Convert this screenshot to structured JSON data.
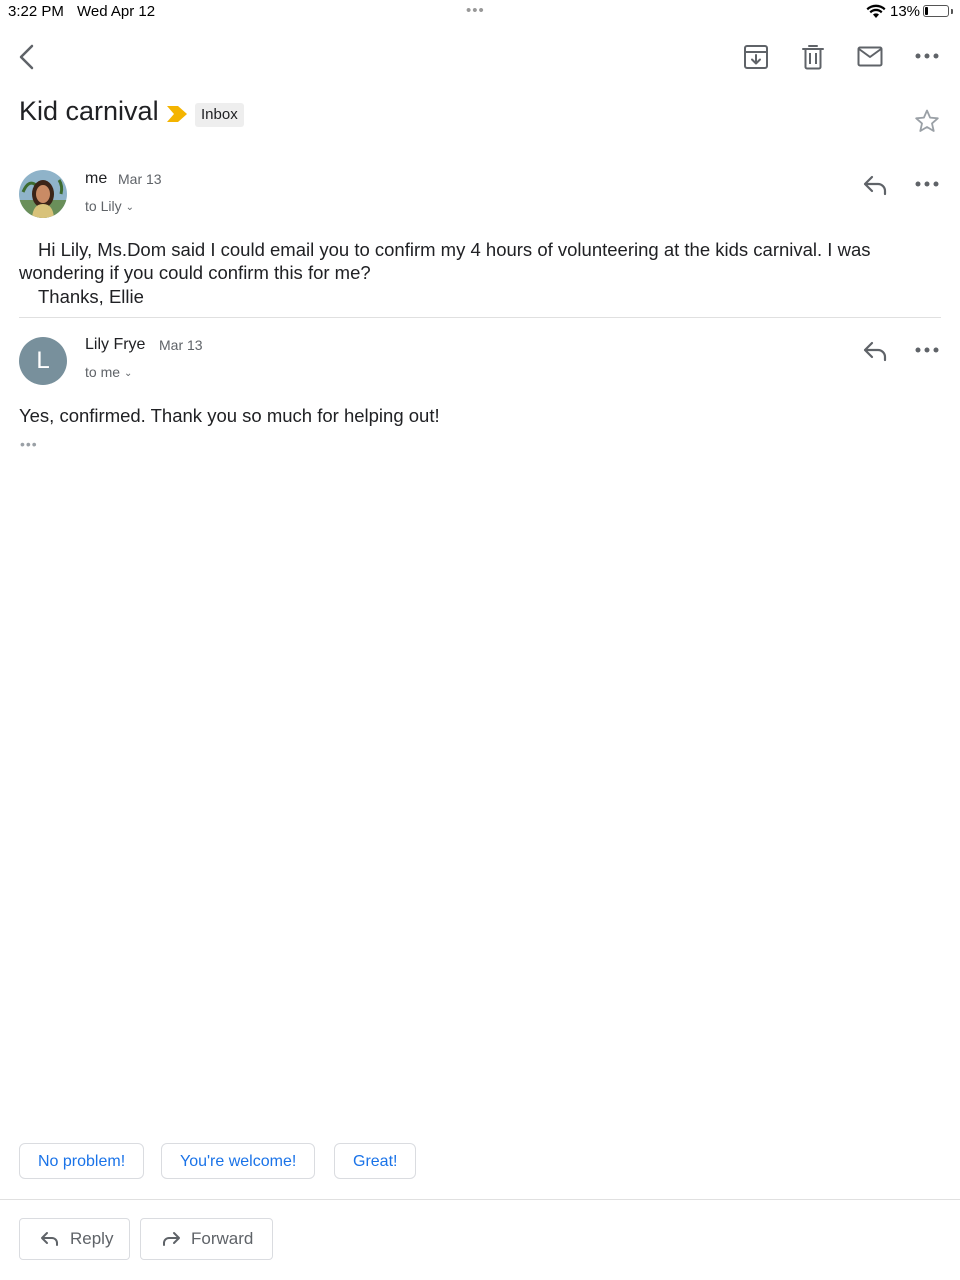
{
  "status_bar": {
    "time": "3:22 PM",
    "date": "Wed Apr 12",
    "multitask_dots": "•••",
    "battery_percent": "13%",
    "battery_level": 0.13,
    "wifi_icon": "wifi-icon",
    "battery_icon": "battery-icon"
  },
  "toolbar": {
    "icons": [
      "back-arrow-icon",
      "archive-icon",
      "trash-icon",
      "mail-icon",
      "more-horizontal-icon"
    ]
  },
  "thread": {
    "subject": "Kid carnival",
    "importance_marker": "importance-marker-icon",
    "importance_color": "#f4b400",
    "label": "Inbox",
    "star_icon": "star-outline-icon"
  },
  "messages": [
    {
      "sender": "me",
      "date": "Mar 13",
      "to": "to Lily",
      "avatar": "photo",
      "body": [
        "Hi Lily, Ms.Dom said I could email you to confirm my 4 hours of volunteering at the kids carnival. I was",
        "wondering if you could confirm this for me?",
        "Thanks, Ellie"
      ]
    },
    {
      "sender": "Lily Frye",
      "date": "Mar 13",
      "to": "to me",
      "avatar_letter": "L",
      "avatar_color": "#78909c",
      "body": [
        "Yes, confirmed. Thank you so much for helping out!"
      ],
      "trimmed_content": "•••"
    }
  ],
  "smart_replies": [
    "No problem!",
    "You're welcome!",
    "Great!"
  ],
  "actions": {
    "reply": "Reply",
    "forward": "Forward"
  },
  "colors": {
    "accent": "#1a73e8",
    "secondary_text": "#5f6368",
    "divider": "#e0e0e0"
  }
}
